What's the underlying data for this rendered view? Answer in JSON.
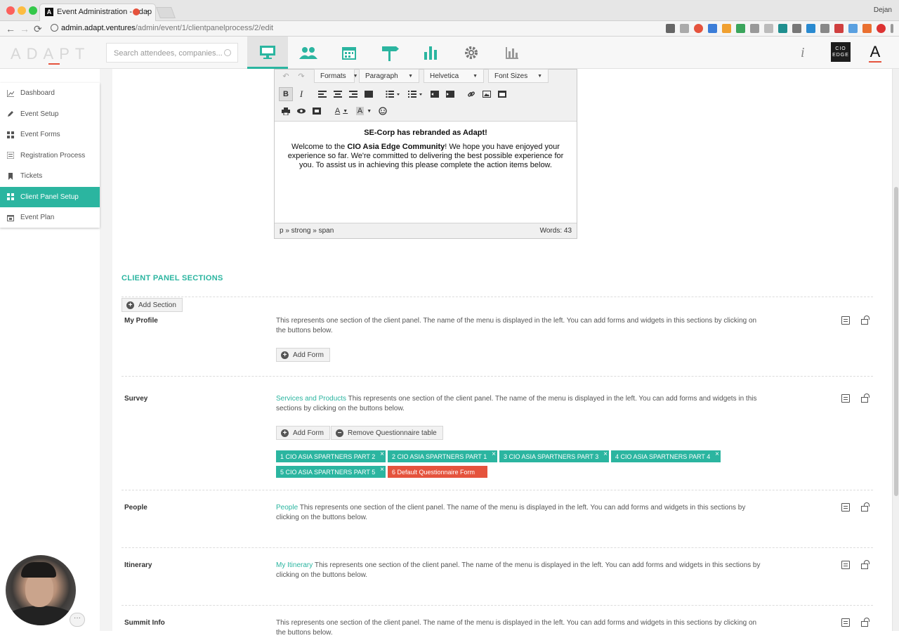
{
  "browser": {
    "tab_title": "Event Administration - Adap",
    "tab_close": "×",
    "favicon_letter": "A",
    "profile_name": "Dejan",
    "url_host": "admin.adapt.ventures",
    "url_path": "/admin/event/1/clientpanelprocess/2/edit",
    "back_glyph": "←",
    "forward_glyph": "→",
    "reload_glyph": "⟳"
  },
  "header": {
    "logo_text": "ADAPT",
    "search_placeholder": "Search attendees, companies...",
    "info_glyph": "i",
    "cio_logo_text": "CIO EDGE",
    "a_logo_text": "A",
    "nav_icons": [
      "monitor-icon",
      "users-icon",
      "calendar-icon",
      "signpost-icon",
      "bar-chart-icon",
      "gear-icon",
      "report-icon"
    ]
  },
  "sidebar": {
    "items": [
      {
        "label": "Dashboard",
        "icon": "chart-line-icon"
      },
      {
        "label": "Event Setup",
        "icon": "pencil-icon"
      },
      {
        "label": "Event Forms",
        "icon": "grid-icon"
      },
      {
        "label": "Registration Process",
        "icon": "list-icon"
      },
      {
        "label": "Tickets",
        "icon": "bookmark-icon"
      },
      {
        "label": "Client Panel Setup",
        "icon": "tiles-icon",
        "active": true
      },
      {
        "label": "Event Plan",
        "icon": "calendar-icon"
      }
    ]
  },
  "editor": {
    "undo": "↶",
    "redo": "↷",
    "dropdowns": [
      "Formats",
      "Paragraph",
      "Helvetica",
      "Font Sizes"
    ],
    "bold": "B",
    "italic": "I",
    "text_color": "A",
    "bg_color": "A",
    "content_heading": "SE-Corp has rebranded as Adapt!",
    "content_pre": "Welcome to the ",
    "content_strong": "CIO Asia Edge Community",
    "content_post": "! We hope you have enjoyed your experience so far. We're committed to delivering the best possible experience for you. To assist us in achieving this please complete the action items below.",
    "status_path": "p » strong » span",
    "word_count": "Words: 43"
  },
  "sections": {
    "title": "CLIENT PANEL SECTIONS",
    "add_section_label": "Add Section",
    "add_form_label": "Add Form",
    "remove_q_label": "Remove Questionnaire table",
    "rows": [
      {
        "name": "My Profile",
        "link": "",
        "desc": "This represents one section of the client panel. The name of the menu is displayed in the left. You can add forms and widgets in this sections by clicking on the buttons below."
      },
      {
        "name": "Survey",
        "link": "Services and Products",
        "desc": " This represents one section of the client panel. The name of the menu is displayed in the left. You can add forms and widgets in this sections by clicking on the buttons below."
      },
      {
        "name": "People",
        "link": "People",
        "desc": " This represents one section of the client panel. The name of the menu is displayed in the left. You can add forms and widgets in this sections by clicking on the buttons below."
      },
      {
        "name": "Itinerary",
        "link": "My Itinerary",
        "desc": " This represents one section of the client panel. The name of the menu is displayed in the left. You can add forms and widgets in this sections by clicking on the buttons below."
      },
      {
        "name": "Summit Info",
        "link": "",
        "desc": "This represents one section of the client panel. The name of the menu is displayed in the left. You can add forms and widgets in this sections by clicking on the buttons below."
      }
    ],
    "survey_tags": [
      {
        "label": "1 CIO ASIA SPARTNERS PART 2",
        "color": "#2bb5a0"
      },
      {
        "label": "2 CIO ASIA SPARTNERS PART 1",
        "color": "#2bb5a0"
      },
      {
        "label": "3 CIO ASIA SPARTNERS PART 3",
        "color": "#2bb5a0"
      },
      {
        "label": "4 CIO ASIA SPARTNERS PART 4",
        "color": "#2bb5a0"
      },
      {
        "label": "5 CIO ASIA SPARTNERS PART 5",
        "color": "#2bb5a0"
      },
      {
        "label": "6 Default Questionnaire Form",
        "color": "#e5533d"
      }
    ],
    "tag_remove": "×"
  },
  "misc": {
    "chat_dots": "···"
  },
  "colors": {
    "accent": "#2bb5a0",
    "danger": "#e5533d"
  }
}
